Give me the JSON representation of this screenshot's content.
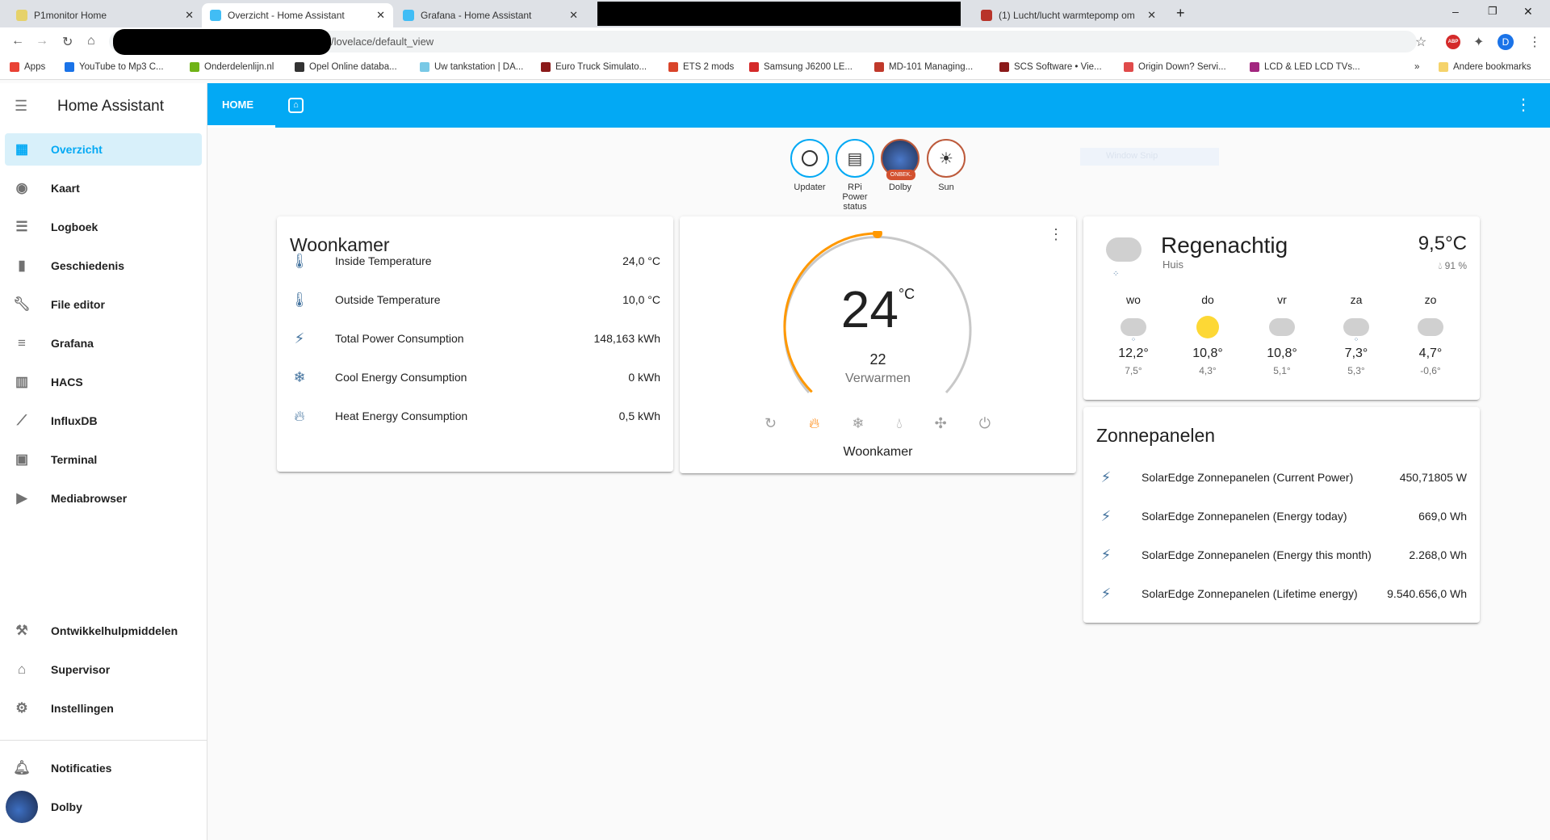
{
  "browser": {
    "tabs": [
      {
        "title": "P1monitor Home"
      },
      {
        "title": "Overzicht - Home Assistant"
      },
      {
        "title": "Grafana - Home Assistant"
      },
      {
        "title": "(1) Lucht/lucht warmtepomp om"
      }
    ],
    "url": "/lovelace/default_view",
    "profile_initial": "D",
    "abp": "ABP",
    "bookmarks": [
      "Apps",
      "YouTube to Mp3 C...",
      "Onderdelenlijn.nl",
      "Opel Online databa...",
      "Uw tankstation | DA...",
      "Euro Truck Simulato...",
      "ETS 2 mods",
      "Samsung J6200 LE...",
      "MD-101 Managing...",
      "SCS Software • Vie...",
      "Origin Down? Servi...",
      "LCD & LED LCD TVs..."
    ],
    "more": "»",
    "other_bookmarks": "Andere bookmarks"
  },
  "sidebar": {
    "title": "Home Assistant",
    "items": [
      {
        "label": "Overzicht"
      },
      {
        "label": "Kaart"
      },
      {
        "label": "Logboek"
      },
      {
        "label": "Geschiedenis"
      },
      {
        "label": "File editor"
      },
      {
        "label": "Grafana"
      },
      {
        "label": "HACS"
      },
      {
        "label": "InfluxDB"
      },
      {
        "label": "Terminal"
      },
      {
        "label": "Mediabrowser"
      }
    ],
    "bottom": [
      {
        "label": "Ontwikkelhulpmiddelen"
      },
      {
        "label": "Supervisor"
      },
      {
        "label": "Instellingen"
      }
    ],
    "notifications": "Notificaties",
    "user": "Dolby"
  },
  "header": {
    "tab": "HOME"
  },
  "badges": [
    {
      "label": "Updater"
    },
    {
      "label": "RPi Power status"
    },
    {
      "label": "Dolby",
      "status": "ONBEK."
    },
    {
      "label": "Sun"
    }
  ],
  "snip": "Window Snip",
  "woonkamer": {
    "title": "Woonkamer",
    "rows": [
      {
        "name": "Inside Temperature",
        "value": "24,0 °C"
      },
      {
        "name": "Outside Temperature",
        "value": "10,0 °C"
      },
      {
        "name": "Total Power Consumption",
        "value": "148,163 kWh"
      },
      {
        "name": "Cool Energy Consumption",
        "value": "0 kWh"
      },
      {
        "name": "Heat Energy Consumption",
        "value": "0,5 kWh"
      }
    ]
  },
  "thermostat": {
    "current": "24",
    "unit": "°C",
    "target": "22",
    "mode": "Verwarmen",
    "name": "Woonkamer",
    "target_fraction": 0.5
  },
  "weather": {
    "state": "Regenachtig",
    "location": "Huis",
    "temp": "9,5°C",
    "humidity": "91 %",
    "forecast": [
      {
        "day": "wo",
        "high": "12,2°",
        "low": "7,5°",
        "icon": "rainy"
      },
      {
        "day": "do",
        "high": "10,8°",
        "low": "4,3°",
        "icon": "sunny"
      },
      {
        "day": "vr",
        "high": "10,8°",
        "low": "5,1°",
        "icon": "cloudy"
      },
      {
        "day": "za",
        "high": "7,3°",
        "low": "5,3°",
        "icon": "rainy"
      },
      {
        "day": "zo",
        "high": "4,7°",
        "low": "-0,6°",
        "icon": "cloudy"
      }
    ]
  },
  "solar": {
    "title": "Zonnepanelen",
    "rows": [
      {
        "name": "SolarEdge Zonnepanelen (Current Power)",
        "value": "450,71805 W"
      },
      {
        "name": "SolarEdge Zonnepanelen (Energy today)",
        "value": "669,0 Wh"
      },
      {
        "name": "SolarEdge Zonnepanelen (Energy this month)",
        "value": "2.268,0 Wh"
      },
      {
        "name": "SolarEdge Zonnepanelen (Lifetime energy)",
        "value": "9.540.656,0 Wh"
      }
    ]
  }
}
